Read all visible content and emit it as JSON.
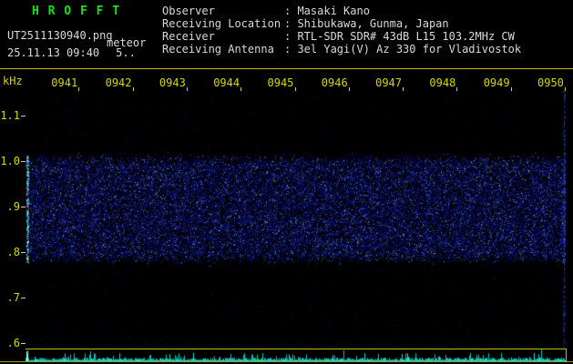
{
  "header": {
    "title": "H R O F F T",
    "file_name": "UT2511130940.png",
    "mode_label": "meteor",
    "timestamp": "25.11.13 09:40",
    "counter": "5..",
    "info": [
      {
        "label": "Observer",
        "value": ": Masaki Kano"
      },
      {
        "label": "Receiving Location",
        "value": ": Shibukawa, Gunma, Japan"
      },
      {
        "label": "Receiver",
        "value": ": RTL-SDR SDR# 43dB L15 103.2MHz CW"
      },
      {
        "label": "Receiving Antenna",
        "value": ": 3el Yagi(V) Az 330 for Vladivostok"
      }
    ]
  },
  "chart_data": {
    "type": "heatmap",
    "title": "",
    "xlabel": "",
    "ylabel": "kHz",
    "x_tick_labels": [
      "0941",
      "0942",
      "0943",
      "0944",
      "0945",
      "0946",
      "0947",
      "0948",
      "0949",
      "0950"
    ],
    "y_tick_labels": [
      "1.1",
      "1.0",
      ".9",
      ".8",
      ".7",
      ".6"
    ],
    "y_tick_values": [
      1.1,
      1.0,
      0.9,
      0.8,
      0.7,
      0.6
    ],
    "y_range": [
      0.588,
      1.154
    ],
    "grid": false,
    "legend_position": "none",
    "noise": {
      "seed": 42,
      "band_khz": [
        0.785,
        1.005
      ],
      "band_count": 36000,
      "bg_count": 3000,
      "band_color": "#1020c8",
      "bright_color": "#a0d8ff",
      "left_marker_colors": [
        "#00f0dc",
        "#8cffb4",
        "#ebffff",
        "#ff2820"
      ],
      "right_edge_color": "#3c5aff"
    },
    "bottom_strip": {
      "type": "intensity-trace",
      "color": "#00c6c6"
    }
  }
}
